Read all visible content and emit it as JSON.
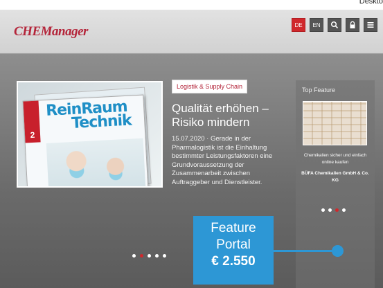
{
  "corner_label": "Deskto",
  "header": {
    "logo": "CHEManager",
    "lang_de": "DE",
    "lang_en": "EN",
    "icons": [
      "search-icon",
      "lock-icon",
      "menu-icon"
    ]
  },
  "article": {
    "category": "Logistik & Supply Chain",
    "title": "Qualität erhöhen – Risiko mindern",
    "teaser": "15.07.2020 · Gerade in der Pharmalogistik ist die Einhaltung bestimmter Leistungsfaktoren eine Grundvoraussetzung der Zusammenarbeit zwischen Auftraggeber und Dienstleister.",
    "magazine_title_1": "ReinRaum",
    "magazine_title_2": "Technik",
    "magazine_issue": "2",
    "slider_dots": 5,
    "active_dot": 1
  },
  "top_feature": {
    "title": "Top Feature",
    "caption": "Chemikalien sicher und einfach online kaufen",
    "company": "BÜFA Chemikalien GmbH & Co. KG",
    "dots": 4,
    "active_dot": 2
  },
  "promo": {
    "line1": "Feature",
    "line2": "Portal",
    "price": "€ 2.550"
  },
  "colors": {
    "brand_red": "#b4253a",
    "promo_blue": "#2d97d5"
  }
}
